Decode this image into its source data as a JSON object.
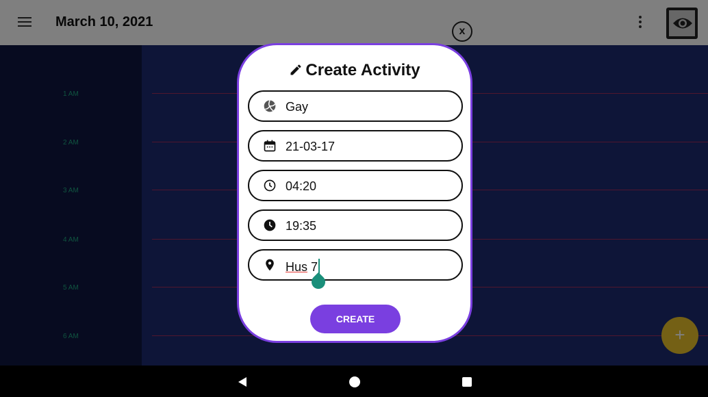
{
  "appbar": {
    "title": "March 10, 2021",
    "menu_icon": "hamburger-menu-icon",
    "more_icon": "more-vert-icon",
    "eye_icon": "eye-icon"
  },
  "calendar": {
    "hours": [
      "1 AM",
      "2 AM",
      "3 AM",
      "4 AM",
      "5 AM",
      "6 AM"
    ],
    "line_color": "#a02c5c",
    "label_color": "#1fa77f",
    "background": "#1c2a70",
    "fab_label": "+",
    "fab_color": "#e9c02a"
  },
  "dialog": {
    "close_label": "x",
    "title": "Create Activity",
    "title_icon": "pencil-icon",
    "fields": [
      {
        "icon": "volleyball-icon",
        "value": "Gay"
      },
      {
        "icon": "calendar-icon",
        "value": "21-03-17"
      },
      {
        "icon": "clock-outline-icon",
        "value": "04:20"
      },
      {
        "icon": "clock-filled-icon",
        "value": "19:35"
      },
      {
        "icon": "location-pin-icon",
        "value_word": "Hus",
        "value_rest": " 7"
      }
    ],
    "create_label": "CREATE",
    "accent_color": "#7a3fe0"
  },
  "navbar": {
    "back_icon": "back-triangle-icon",
    "home_icon": "home-circle-icon",
    "recent_icon": "recents-square-icon"
  }
}
